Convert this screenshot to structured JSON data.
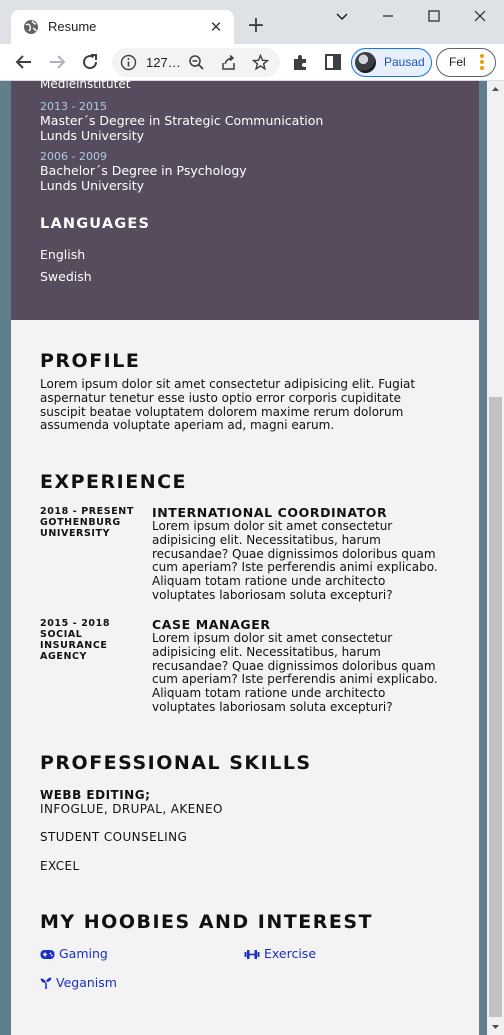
{
  "browser": {
    "tab_title": "Resume",
    "new_tab": "+",
    "url": "127…",
    "profile_label": "Pausad",
    "error_label": "Fel"
  },
  "sidebar": {
    "cut_text": "Medieinstitutet",
    "education": [
      {
        "years": "2013 - 2015",
        "degree": "Master´s Degree in Strategic Communication",
        "school": "Lunds University"
      },
      {
        "years": "2006 - 2009",
        "degree": "Bachelor´s Degree in Psychology",
        "school": "Lunds University"
      }
    ],
    "languages_heading": "LANGUAGES",
    "languages": [
      "English",
      "Swedish"
    ]
  },
  "profile": {
    "heading": "PROFILE",
    "text": "Lorem ipsum dolor sit amet consectetur adipisicing elit. Fugiat aspernatur tenetur esse iusto optio error corporis cupiditate suscipit beatae voluptatem dolorem maxime rerum dolorum assumenda voluptate aperiam ad, magni earum."
  },
  "experience": {
    "heading": "EXPERIENCE",
    "items": [
      {
        "years": "2018 - PRESENT",
        "org": "GOTHENBURG UNIVERSITY",
        "title": "INTERNATIONAL COORDINATOR",
        "desc": "Lorem ipsum dolor sit amet consectetur adipisicing elit. Necessitatibus, harum recusandae? Quae dignissimos doloribus quam cum aperiam? Iste perferendis animi explicabo. Aliquam totam ratione unde architecto voluptates laboriosam soluta excepturi?"
      },
      {
        "years": "2015 - 2018",
        "org": "SOCIAL INSURANCE AGENCY",
        "title": "CASE MANAGER",
        "desc": "Lorem ipsum dolor sit amet consectetur adipisicing elit. Necessitatibus, harum recusandae? Quae dignissimos doloribus quam cum aperiam? Iste perferendis animi explicabo. Aliquam totam ratione unde architecto voluptates laboriosam soluta excepturi?"
      }
    ]
  },
  "skills": {
    "heading": "PROFESSIONAL SKILLS",
    "web_label": "WEBB EDITING;",
    "web_items": "INFOGLUE, DRUPAL, AKENEO",
    "counseling": "STUDENT COUNSELING",
    "excel": "EXCEL"
  },
  "hobbies": {
    "heading": "MY HOOBIES AND INTEREST",
    "items": [
      {
        "label": "Gaming",
        "icon": "gamepad-icon"
      },
      {
        "label": "Exercise",
        "icon": "dumbbell-icon"
      },
      {
        "label": "Veganism",
        "icon": "seedling-icon"
      }
    ]
  },
  "colors": {
    "sidebar_bg": "#574c5e",
    "main_bg": "#f3f3f3",
    "page_bg": "#5f7f8a",
    "accent_years": "#a8cbe0",
    "link": "#1a2fc4"
  }
}
